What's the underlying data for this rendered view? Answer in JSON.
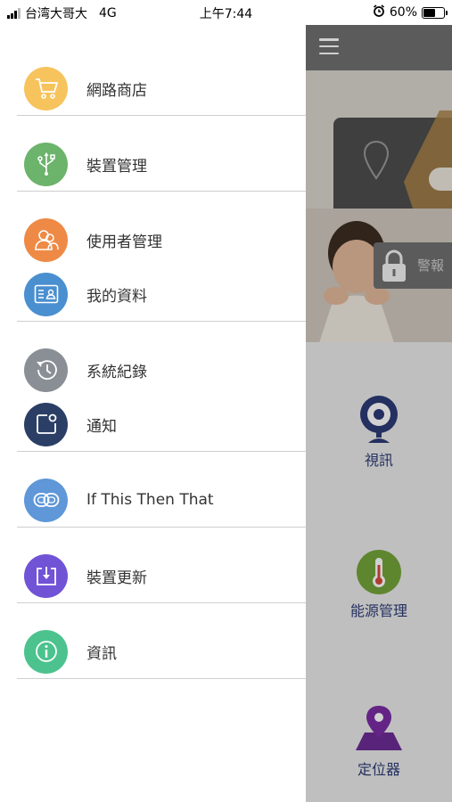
{
  "status": {
    "carrier": "台湾大哥大",
    "network": "4G",
    "time": "上午7:44",
    "battery": "60%",
    "battery_level": 0.6
  },
  "drawer": {
    "items": [
      {
        "label": "網路商店",
        "icon": "shopping-cart-icon",
        "color": "#f7c35d"
      },
      {
        "label": "裝置管理",
        "icon": "usb-icon",
        "color": "#6cb36c"
      },
      {
        "label": "使用者管理",
        "icon": "users-icon",
        "color": "#ee8a46"
      },
      {
        "label": "我的資料",
        "icon": "id-card-icon",
        "color": "#4a8fcf"
      },
      {
        "label": "系統紀錄",
        "icon": "history-clock-icon",
        "color": "#8a8f95"
      },
      {
        "label": "通知",
        "icon": "notification-icon",
        "color": "#2b3f66"
      },
      {
        "label": "If This Then That",
        "icon": "link-chain-icon",
        "color": "#5f97d8"
      },
      {
        "label": "裝置更新",
        "icon": "download-update-icon",
        "color": "#7153d6"
      },
      {
        "label": "資訊",
        "icon": "info-icon",
        "color": "#4cc38e"
      }
    ]
  },
  "main": {
    "alarm_label": "警報",
    "tiles": {
      "video": "視訊",
      "energy": "能源管理",
      "locator": "定位器"
    }
  }
}
